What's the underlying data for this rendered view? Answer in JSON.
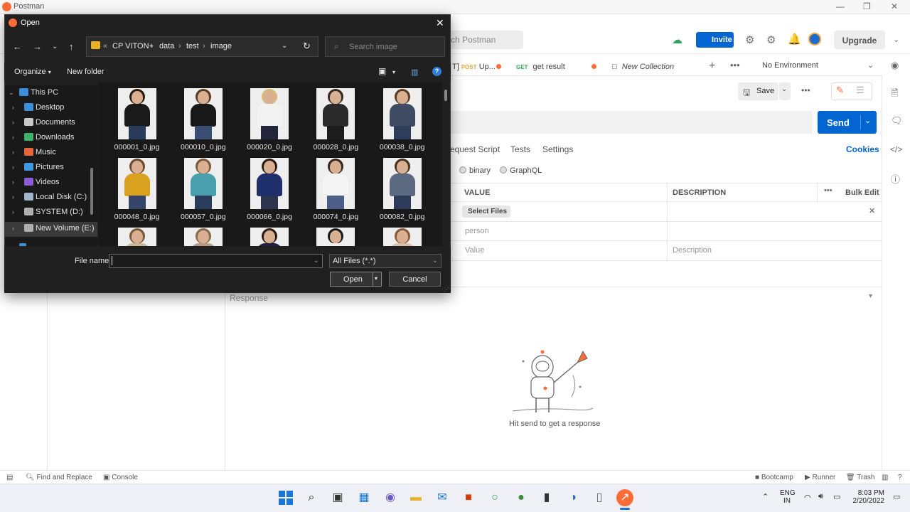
{
  "postman": {
    "title": "Postman",
    "search_placeholder": "rch Postman",
    "invite": "Invite",
    "upgrade": "Upgrade",
    "tabs": [
      {
        "method": "POST",
        "name": "Up...",
        "prefix": "T]"
      },
      {
        "method": "GET",
        "name": "get result"
      },
      {
        "name": "New Collection"
      }
    ],
    "environment": "No Environment",
    "save": "Save",
    "send": "Send",
    "request_tabs": [
      "equest Script",
      "Tests",
      "Settings"
    ],
    "cookies": "Cookies",
    "body_types": [
      "binary",
      "GraphQL"
    ],
    "table": {
      "headers": [
        "VALUE",
        "DESCRIPTION",
        "Bulk Edit"
      ],
      "select_files": "Select Files",
      "row2_key": "person",
      "value_placeholder": "Value",
      "description_placeholder": "Description"
    },
    "response_label": "Response",
    "hit_send": "Hit send to get a response",
    "bottom": {
      "find_replace": "Find and Replace",
      "console": "Console",
      "bootcamp": "Bootcamp",
      "runner": "Runner",
      "trash": "Trash"
    }
  },
  "dialog": {
    "title": "Open",
    "breadcrumb": [
      "CP VITON+",
      "data",
      "test",
      "image"
    ],
    "search_placeholder": "Search image",
    "organize": "Organize",
    "new_folder": "New folder",
    "nav_items": [
      {
        "label": "This PC",
        "color": "#3b8edb"
      },
      {
        "label": "Desktop",
        "color": "#3c8fd8"
      },
      {
        "label": "Documents",
        "color": "#c9c9c9"
      },
      {
        "label": "Downloads",
        "color": "#3fb26b"
      },
      {
        "label": "Music",
        "color": "#e8643c"
      },
      {
        "label": "Pictures",
        "color": "#3e9ae0"
      },
      {
        "label": "Videos",
        "color": "#8e5ad8"
      },
      {
        "label": "Local Disk (C:)",
        "color": "#9fb5c9"
      },
      {
        "label": "SYSTEM (D:)",
        "color": "#b0b0b0"
      },
      {
        "label": "New Volume (E:)",
        "color": "#b0b0b0"
      }
    ],
    "files": [
      {
        "name": "000001_0.jpg",
        "top": "#1a1a1a",
        "bottom": "#2a3a5a",
        "hair": "#2b1d14"
      },
      {
        "name": "000010_0.jpg",
        "top": "#181818",
        "bottom": "#3a4e74",
        "hair": "#5a3c22"
      },
      {
        "name": "000020_0.jpg",
        "top": "#f2f2f2",
        "bottom": "#22263a",
        "hair": "#d8b878"
      },
      {
        "name": "000028_0.jpg",
        "top": "#2a2a2a",
        "bottom": "#1c1c1c",
        "hair": "#3b2a1e"
      },
      {
        "name": "000038_0.jpg",
        "top": "#3f4a63",
        "bottom": "#2f3d5a",
        "hair": "#5a3d27"
      },
      {
        "name": "000048_0.jpg",
        "top": "#d9a11d",
        "bottom": "#34456a",
        "hair": "#6e4b2c"
      },
      {
        "name": "000057_0.jpg",
        "top": "#4a9fae",
        "bottom": "#2a3c5c",
        "hair": "#7a5a3a"
      },
      {
        "name": "000066_0.jpg",
        "top": "#1f2f6b",
        "bottom": "#2b3550",
        "hair": "#2b1d14"
      },
      {
        "name": "000074_0.jpg",
        "top": "#f4f4f4",
        "bottom": "#4d5f86",
        "hair": "#3a2a1e"
      },
      {
        "name": "000082_0.jpg",
        "top": "#5a6880",
        "bottom": "#2d3a58",
        "hair": "#4a3420"
      },
      {
        "name": "",
        "top": "#c9b79a",
        "bottom": "#c9b79a",
        "hair": "#7a5a3a"
      },
      {
        "name": "",
        "top": "#b79a86",
        "bottom": "#b79a86",
        "hair": "#8a6a4a"
      },
      {
        "name": "",
        "top": "#1f2240",
        "bottom": "#1f2240",
        "hair": "#2b1d14"
      },
      {
        "name": "",
        "top": "#efefef",
        "bottom": "#efefef",
        "hair": "#1a1a1a"
      },
      {
        "name": "",
        "top": "#d8c0a8",
        "bottom": "#d8c0a8",
        "hair": "#8a5a3a"
      }
    ],
    "file_name_label": "File name:",
    "file_name_value": "",
    "file_type": "All Files (*.*)",
    "open": "Open",
    "cancel": "Cancel"
  },
  "taskbar": {
    "lang": "ENG",
    "region": "IN",
    "time": "8:03 PM",
    "date": "2/20/2022"
  }
}
